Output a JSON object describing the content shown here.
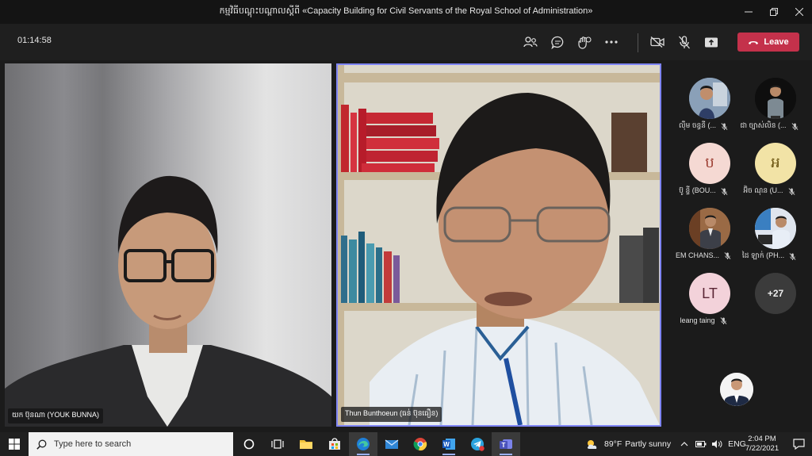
{
  "window": {
    "title": "កម្មវិធីបណ្តុះបណ្តាលស្តីពី «Capacity Building for Civil Servants of the Royal School of Administration»"
  },
  "toolbar": {
    "timer": "01:14:58",
    "leave_label": "Leave",
    "leave_color": "#c4314b"
  },
  "videos": [
    {
      "name": "យក ប៊ុនណា (YOUK BUNNA)"
    },
    {
      "name": "Thun Bunthoeun (ធន់ ប៊ុនធឿន)",
      "highlight_color": "#7f85f5"
    }
  ],
  "participants": [
    {
      "name": "ល៉ឹម ចន្ធនី (...",
      "avatar": "photo",
      "muted": true
    },
    {
      "name": "ជា ច្បាស់លិន (...",
      "avatar": "photo",
      "muted": true
    },
    {
      "name": "ប៊ូ ន្ទី (BOU...",
      "avatar": "ប",
      "avatar_bg": "#f5d9d3",
      "avatar_fg": "#9a3a2e",
      "muted": true
    },
    {
      "name": "អ៊ិច ណុន (U...",
      "avatar": "អ",
      "avatar_bg": "#f2e3a6",
      "avatar_fg": "#6b5410",
      "muted": true
    },
    {
      "name": "EM CHANS...",
      "avatar": "photo",
      "muted": true
    },
    {
      "name": "ដៃ ឡាក់ (PH...",
      "avatar": "photo",
      "muted": true
    },
    {
      "name": "leang taing",
      "avatar": "LT",
      "avatar_bg": "#f3d2da",
      "avatar_fg": "#5a2534",
      "muted": true
    }
  ],
  "more_participants": "+27",
  "taskbar": {
    "search_placeholder": "Type here to search",
    "weather_temp": "89°F",
    "weather_text": "Partly sunny",
    "language": "ENG",
    "time": "2:04 PM",
    "date": "7/22/2021"
  }
}
